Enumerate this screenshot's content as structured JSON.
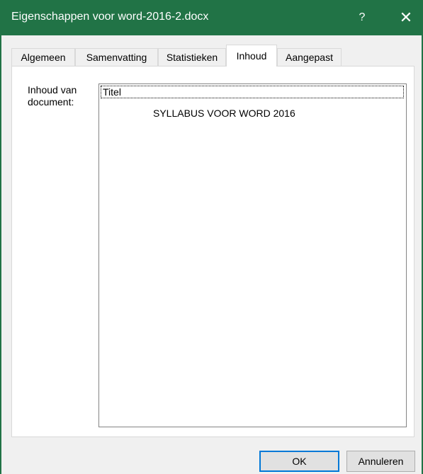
{
  "window": {
    "title": "Eigenschappen voor word-2016-2.docx",
    "help_label": "?",
    "close_label": "✕",
    "accent_color": "#217346"
  },
  "tabs": [
    {
      "label": "Algemeen",
      "active": false
    },
    {
      "label": "Samenvatting",
      "active": false
    },
    {
      "label": "Statistieken",
      "active": false
    },
    {
      "label": "Inhoud",
      "active": true
    },
    {
      "label": "Aangepast",
      "active": false
    }
  ],
  "content": {
    "label": "Inhoud van document:",
    "heading": "Titel",
    "value": "SYLLABUS VOOR WORD 2016"
  },
  "buttons": {
    "ok": "OK",
    "cancel": "Annuleren"
  }
}
